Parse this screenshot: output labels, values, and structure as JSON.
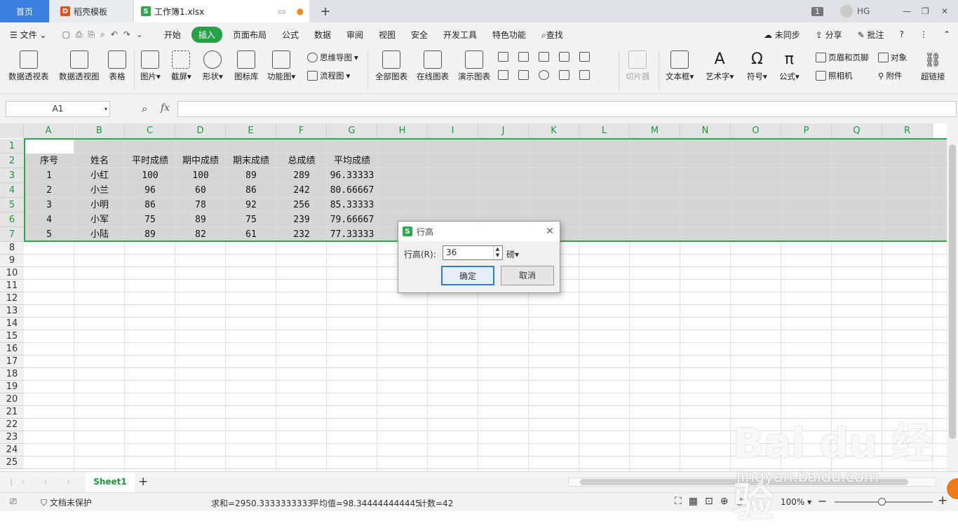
{
  "titlebar": {
    "tabs": [
      {
        "label": "首页"
      },
      {
        "label": "稻壳模板"
      },
      {
        "label": "工作簿1.xlsx"
      }
    ],
    "badge": "1",
    "user": "HG"
  },
  "menu": {
    "items": [
      "文件",
      "开始",
      "插入",
      "页面布局",
      "公式",
      "数据",
      "审阅",
      "视图",
      "安全",
      "开发工具",
      "特色功能",
      "查找"
    ],
    "active": "插入",
    "right": [
      "未同步",
      "分享",
      "批注"
    ]
  },
  "ribbon": {
    "big": [
      "数据透视表",
      "数据透视图",
      "表格",
      "图片",
      "截屏",
      "形状",
      "图标库",
      "功能图",
      "全部图表",
      "在线图表",
      "演示图表",
      "切片器",
      "文本框",
      "艺术字",
      "符号",
      "公式",
      "超链接"
    ],
    "small": [
      "思维导图",
      "流程图",
      "页眉和页脚",
      "照相机",
      "对象",
      "附件"
    ]
  },
  "formula_bar": {
    "name_box": "A1",
    "fx": "fx"
  },
  "columns": [
    "A",
    "B",
    "C",
    "D",
    "E",
    "F",
    "G",
    "H",
    "I",
    "J",
    "K",
    "L",
    "M",
    "N",
    "O",
    "P",
    "Q",
    "R"
  ],
  "rows": [
    "1",
    "2",
    "3",
    "4",
    "5",
    "6",
    "7",
    "8",
    "9",
    "10",
    "11",
    "12",
    "13",
    "14",
    "15",
    "16",
    "17",
    "18",
    "19",
    "20",
    "21",
    "22",
    "23",
    "24",
    "25"
  ],
  "table": {
    "headers": [
      "序号",
      "姓名",
      "平时成绩",
      "期中成绩",
      "期末成绩",
      "总成绩",
      "平均成绩"
    ],
    "data": [
      [
        "1",
        "小红",
        "100",
        "100",
        "89",
        "289",
        "96.33333"
      ],
      [
        "2",
        "小兰",
        "96",
        "60",
        "86",
        "242",
        "80.66667"
      ],
      [
        "3",
        "小明",
        "86",
        "78",
        "92",
        "256",
        "85.33333"
      ],
      [
        "4",
        "小军",
        "75",
        "89",
        "75",
        "239",
        "79.66667"
      ],
      [
        "5",
        "小陆",
        "89",
        "82",
        "61",
        "232",
        "77.33333"
      ]
    ]
  },
  "sheet": {
    "tab": "Sheet1"
  },
  "status": {
    "protect": "文档未保护",
    "sum": "求和=2950.3333333333",
    "avg": "平均值=98.344444444445",
    "count": "计数=42",
    "zoom": "100%"
  },
  "dialog": {
    "title": "行高",
    "label": "行高(R):",
    "value": "36",
    "unit": "磅",
    "ok": "确定",
    "cancel": "取消"
  },
  "watermark": {
    "logo": "Bai du 经验",
    "url": "jingyan.baidu.com"
  }
}
